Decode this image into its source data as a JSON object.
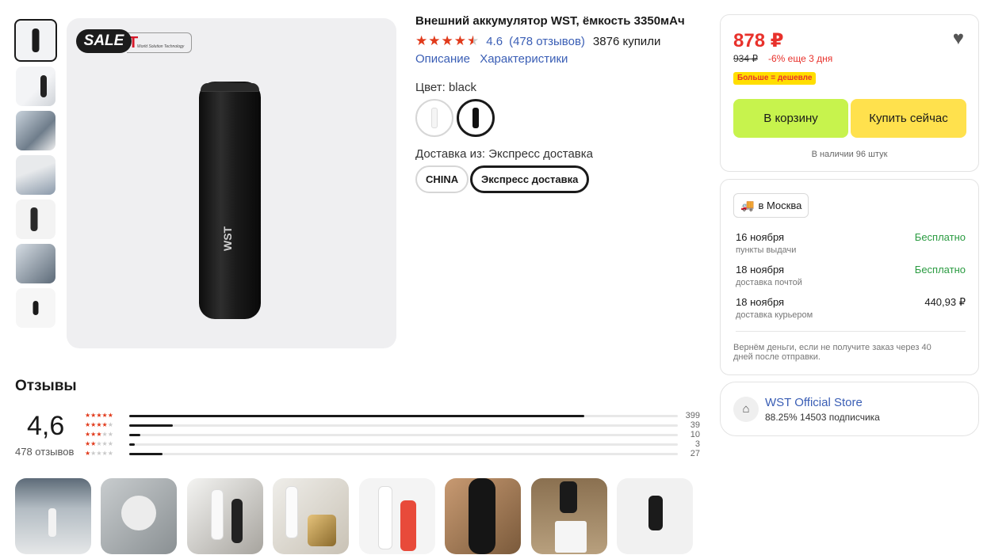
{
  "product": {
    "title": "Внешний аккумулятор WST, ёмкость 3350мАч",
    "stars": "★★★★",
    "half_star": "★",
    "rating": "4.6",
    "reviews_link": "(478 отзывов)",
    "bought": "3876 купили",
    "tabs": [
      "Описание",
      "Характеристики"
    ],
    "color_label": "Цвет: black",
    "shipping_label": "Доставка из: Экспресс доставка",
    "shipping_options": [
      "CHINA",
      "Экспресс доставка"
    ],
    "sale_badge": "SALE",
    "logo_letter": "T",
    "logo_text": "World Solution Technology",
    "device_logo": "WST",
    "main_icon": "heart-icon"
  },
  "price": {
    "current": "878 ₽",
    "old": "934 ₽",
    "discount": "-6% еще 3 дня",
    "promo": "Больше = дешевле",
    "cart_button": "В корзину",
    "buy_now_button": "Купить сейчас",
    "stock": "В наличии 96 штук",
    "accent": "#e8312b"
  },
  "delivery": {
    "city": "в Москва",
    "rows": [
      {
        "date": "16 ноября",
        "method": "пункты выдачи",
        "price": "Бесплатно"
      },
      {
        "date": "18 ноября",
        "method": "доставка почтой",
        "price": "Бесплатно"
      },
      {
        "date": "18 ноября",
        "method": "доставка курьером",
        "price": "440,93 ₽"
      }
    ],
    "refund": "Вернём деньги, если не получите заказ через 40 дней после отправки."
  },
  "store": {
    "name": "WST Official Store",
    "meta": "88.25%  14503 подписчика"
  },
  "reviews": {
    "title": "Отзывы",
    "score": "4,6",
    "count": "478 отзывов",
    "distribution": [
      {
        "stars": 5,
        "count": "399",
        "fraction": 0.83
      },
      {
        "stars": 4,
        "count": "39",
        "fraction": 0.08
      },
      {
        "stars": 3,
        "count": "10",
        "fraction": 0.02
      },
      {
        "stars": 2,
        "count": "3",
        "fraction": 0.01
      },
      {
        "stars": 1,
        "count": "27",
        "fraction": 0.06
      }
    ]
  }
}
